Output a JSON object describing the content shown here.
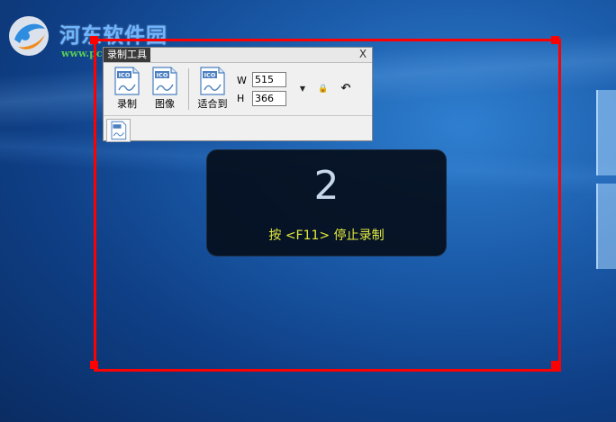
{
  "watermark": {
    "title": "河东软件园",
    "url": "www.pc0359.cn"
  },
  "toolbar_window": {
    "title": "录制工具",
    "close_glyph": "X",
    "buttons": [
      {
        "label": "录制",
        "icon": "ico-file-icon"
      },
      {
        "label": "图像",
        "icon": "ico-file-icon"
      },
      {
        "label": "适合到",
        "icon": "ico-file-icon"
      }
    ],
    "icon_text": "ICO",
    "width_label": "W",
    "width_value": "515",
    "height_label": "H",
    "height_value": "366",
    "dropdown_glyph": "▼",
    "lock_glyph": "🔒",
    "rotate_glyph": "↶"
  },
  "countdown": {
    "number": "2",
    "message": "按 <F11> 停止录制"
  },
  "colors": {
    "selection_frame": "#ff0000",
    "countdown_text": "#e3ea3e",
    "desktop_blue": "#1a5aa8"
  }
}
